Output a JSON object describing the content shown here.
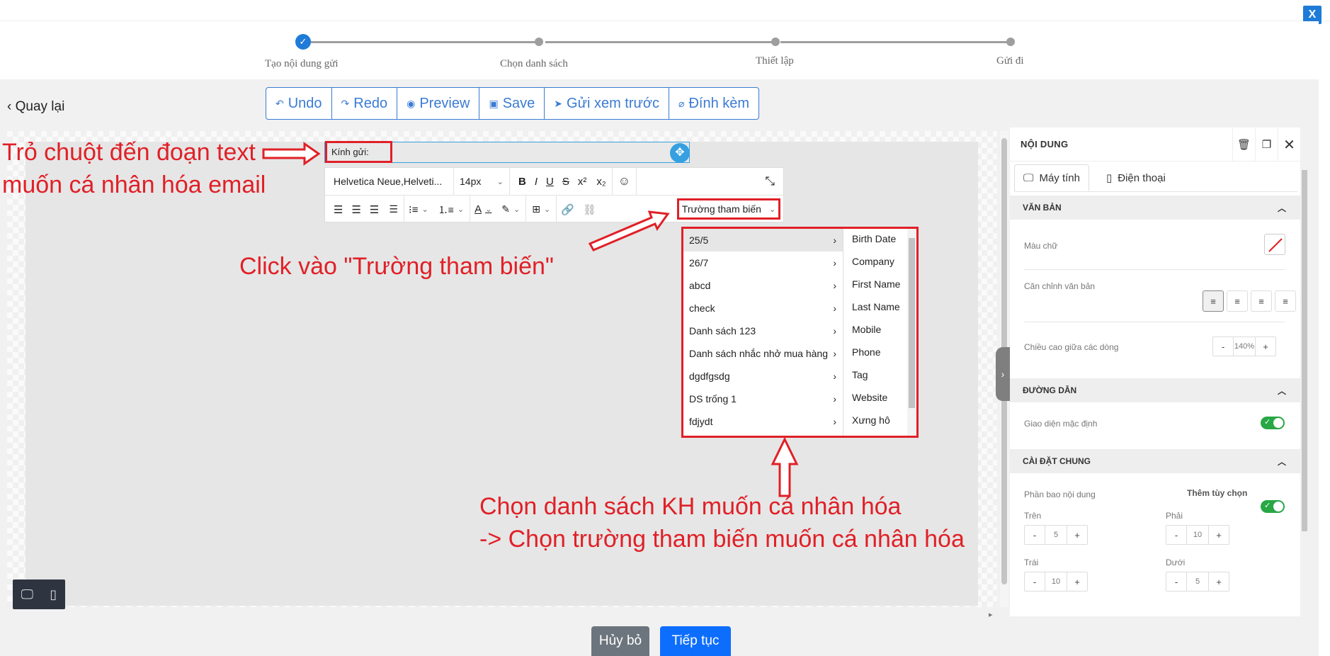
{
  "close_label": "X",
  "steps": [
    {
      "label": "Tạo nội dung gửi"
    },
    {
      "label": "Chọn danh sách"
    },
    {
      "label": "Thiết lập"
    },
    {
      "label": "Gửi đi"
    }
  ],
  "back_label": "Quay lại",
  "toolbar": {
    "undo": "Undo",
    "redo": "Redo",
    "preview": "Preview",
    "save": "Save",
    "send_preview": "Gửi xem trước",
    "attach": "Đính kèm"
  },
  "editor": {
    "text_block": "Kính gửi:",
    "font_family": "Helvetica Neue,Helveti...",
    "font_size": "14px",
    "variable_dropdown": "Trường tham biến"
  },
  "menu": {
    "lists": [
      "25/5",
      "26/7",
      "abcd",
      "check",
      "Danh sách 123",
      "Danh sách nhắc nhở mua hàng",
      "dgdfgsdg",
      "DS trống 1",
      "fdjydt"
    ],
    "fields": [
      "Birth Date",
      "Company",
      "First Name",
      "Last Name",
      "Mobile",
      "Phone",
      "Tag",
      "Website",
      "Xưng hô"
    ]
  },
  "annotations": {
    "hover_line1": "Trỏ chuột đến đoạn text",
    "hover_line2": "muốn cá nhân hóa email",
    "click": "Click vào \"Trường tham biến\"",
    "choose_line1": "Chọn danh sách KH muốn cá nhân hóa",
    "choose_line2": "-> Chọn trường tham biến muốn cá nhân hóa"
  },
  "panel": {
    "title": "NỘI DUNG",
    "tab_desktop": "Máy tính",
    "tab_mobile": "Điện thoại",
    "section_text": "VĂN BẢN",
    "text_color": "Màu chữ",
    "text_align": "Căn chỉnh văn bản",
    "line_height": "Chiều cao giữa các dòng",
    "line_height_value": "140%",
    "section_link": "ĐƯỜNG DẪN",
    "default_style": "Giao diện mặc định",
    "section_general": "CÀI ĐẶT CHUNG",
    "padding": "Phần bao nội dung",
    "more_options": "Thêm tùy chọn",
    "top": "Trên",
    "top_value": "5",
    "right": "Phải",
    "right_value": "10",
    "left": "Trái",
    "left_value": "10",
    "bottom": "Dưới",
    "bottom_value": "5"
  },
  "footer": {
    "cancel": "Hủy bỏ",
    "next": "Tiếp tục"
  },
  "colors": {
    "accent": "#1f7bd8",
    "annotation": "#e02027",
    "toggle_on": "#28a745",
    "primary_button": "#0d6efd",
    "secondary_button": "#6c757d"
  }
}
